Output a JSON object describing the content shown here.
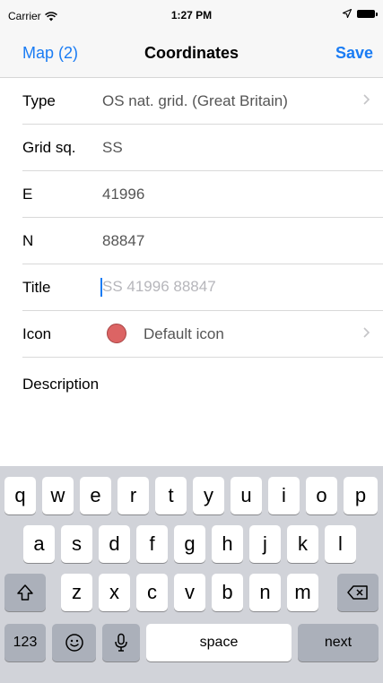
{
  "status_bar": {
    "carrier": "Carrier",
    "time": "1:27 PM"
  },
  "nav": {
    "back_label": "Map (2)",
    "title": "Coordinates",
    "save_label": "Save"
  },
  "form": {
    "type": {
      "label": "Type",
      "value": "OS nat. grid. (Great Britain)"
    },
    "grid_sq": {
      "label": "Grid sq.",
      "value": "SS"
    },
    "easting": {
      "label": "E",
      "value": "41996"
    },
    "northing": {
      "label": "N",
      "value": "88847"
    },
    "title": {
      "label": "Title",
      "value": "",
      "placeholder": "SS 41996 88847"
    },
    "icon": {
      "label": "Icon",
      "value": "Default icon",
      "color": "#dc6464"
    },
    "description": {
      "label": "Description",
      "value": ""
    }
  },
  "keyboard": {
    "row1": [
      "q",
      "w",
      "e",
      "r",
      "t",
      "y",
      "u",
      "i",
      "o",
      "p"
    ],
    "row2": [
      "a",
      "s",
      "d",
      "f",
      "g",
      "h",
      "j",
      "k",
      "l"
    ],
    "row3": [
      "z",
      "x",
      "c",
      "v",
      "b",
      "n",
      "m"
    ],
    "numbers_label": "123",
    "space_label": "space",
    "next_label": "next"
  },
  "colors": {
    "accent": "#1a7cf4",
    "keyboard_bg": "#d1d3d9",
    "key_dark": "#abb0ba"
  }
}
